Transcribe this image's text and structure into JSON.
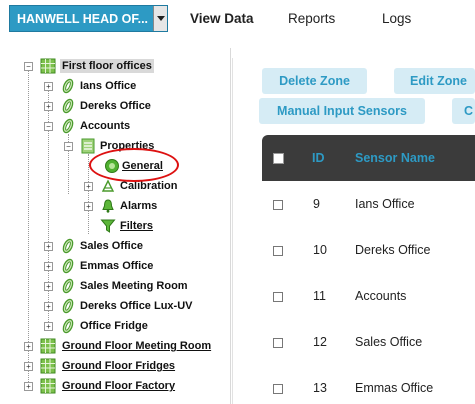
{
  "header": {
    "site_select_value": "HANWELL HEAD OF...",
    "nav": [
      {
        "label": "View Data",
        "active": true
      },
      {
        "label": "Reports",
        "active": false
      },
      {
        "label": "Logs",
        "active": false
      }
    ]
  },
  "tree": {
    "nodes": [
      {
        "label": "First floor offices",
        "icon": "building-grid-icon"
      },
      {
        "label": "Ians Office",
        "icon": "sensor-icon"
      },
      {
        "label": "Dereks Office",
        "icon": "sensor-icon"
      },
      {
        "label": "Accounts",
        "icon": "sensor-icon"
      },
      {
        "label": "Properties",
        "icon": "document-icon"
      },
      {
        "label": "General",
        "icon": "general-circle-icon"
      },
      {
        "label": "Calibration",
        "icon": "calibration-icon"
      },
      {
        "label": "Alarms",
        "icon": "bell-icon"
      },
      {
        "label": "Filters",
        "icon": "funnel-icon"
      },
      {
        "label": "Sales Office",
        "icon": "sensor-icon"
      },
      {
        "label": "Emmas Office",
        "icon": "sensor-icon"
      },
      {
        "label": "Sales Meeting Room",
        "icon": "sensor-icon"
      },
      {
        "label": "Dereks Office Lux-UV",
        "icon": "sensor-icon"
      },
      {
        "label": "Office Fridge",
        "icon": "sensor-icon"
      },
      {
        "label": "Ground Floor Meeting Room",
        "icon": "building-grid-icon"
      },
      {
        "label": "Ground Floor Fridges",
        "icon": "building-grid-icon"
      },
      {
        "label": "Ground Floor Factory",
        "icon": "building-grid-icon"
      }
    ]
  },
  "actions": {
    "delete_zone": "Delete Zone",
    "edit_zone": "Edit Zone",
    "manual_input_sensors": "Manual Input Sensors",
    "partial_button": "C"
  },
  "table": {
    "headers": {
      "id": "ID",
      "sensor_name": "Sensor Name"
    },
    "rows": [
      {
        "id": "9",
        "name": "Ians Office"
      },
      {
        "id": "10",
        "name": "Dereks Office"
      },
      {
        "id": "11",
        "name": "Accounts"
      },
      {
        "id": "12",
        "name": "Sales Office"
      },
      {
        "id": "13",
        "name": "Emmas Office"
      }
    ]
  },
  "colors": {
    "accent": "#2d9ac4",
    "table_header_bg": "#3b3b3b",
    "annotation": "#dd1111"
  }
}
